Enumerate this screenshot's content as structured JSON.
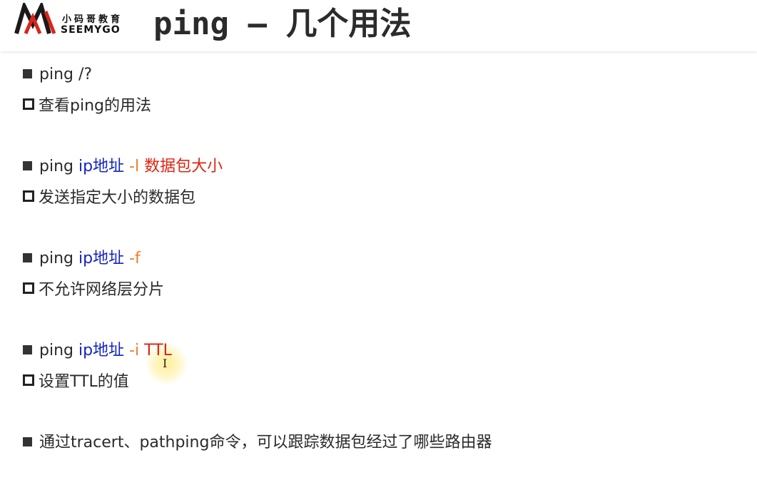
{
  "header": {
    "logo_cn": "小码哥教育",
    "logo_en": "SEEMYGO",
    "title_code": "ping – ",
    "title_cn": "几个用法"
  },
  "items": [
    {
      "command": {
        "ping": "ping /?"
      },
      "desc": "查看ping的用法"
    },
    {
      "command": {
        "ping": "ping ",
        "addr": "ip地址",
        "flag": " -l ",
        "arg": "数据包大小"
      },
      "desc": "发送指定大小的数据包"
    },
    {
      "command": {
        "ping": "ping ",
        "addr": "ip地址",
        "flag": " -f"
      },
      "desc": "不允许网络层分片"
    },
    {
      "command": {
        "ping": "ping ",
        "addr": "ip地址",
        "flag": " -i ",
        "arg": "TTL"
      },
      "desc": "设置TTL的值"
    }
  ],
  "footer_note": "通过tracert、pathping命令，可以跟踪数据包经过了哪些路由器",
  "colors": {
    "address": "#1324c8",
    "flag": "#ee7d2a",
    "argument": "#e0230f"
  },
  "icons": {
    "bullet_level1": "solid-square-icon",
    "bullet_level2": "hollow-square-icon",
    "cursor": "text-cursor-icon"
  }
}
